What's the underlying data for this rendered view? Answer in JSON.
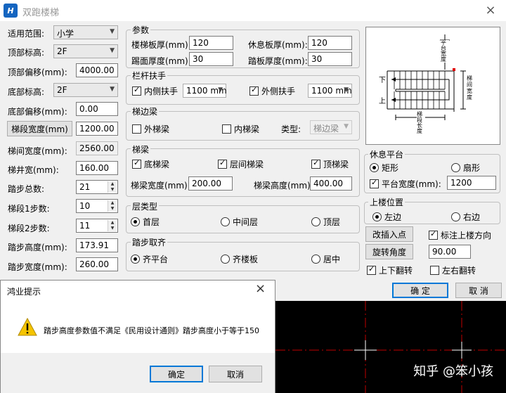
{
  "window": {
    "title": "双跑楼梯",
    "icon": "app-logo-icon",
    "close": "×"
  },
  "left": {
    "scope_label": "适用范围:",
    "scope_value": "小学",
    "top_elev_label": "顶部标高:",
    "top_elev_value": "2F",
    "top_offset_label": "顶部偏移(mm):",
    "top_offset_value": "4000.00",
    "bottom_elev_label": "底部标高:",
    "bottom_elev_value": "2F",
    "bottom_offset_label": "底部偏移(mm):",
    "bottom_offset_value": "0.00",
    "flight_width_button": "梯段宽度(mm)",
    "flight_width_value": "1200.00",
    "gap_width_label": "梯间宽度(mm):",
    "gap_width_value": "2560.00",
    "well_width_label": "梯井宽(mm):",
    "well_width_value": "160.00",
    "total_steps_label": "踏步总数:",
    "total_steps_value": "21",
    "flight1_label": "梯段1步数:",
    "flight1_value": "10",
    "flight2_label": "梯段2步数:",
    "flight2_value": "11",
    "step_height_label": "踏步高度(mm):",
    "step_height_value": "173.91",
    "step_width_label": "踏步宽度(mm):",
    "step_width_value": "260.00"
  },
  "params": {
    "title": "参数",
    "slab_label": "楼梯板厚(mm):",
    "slab_value": "120",
    "landing_label": "休息板厚(mm):",
    "landing_value": "120",
    "riser_label": "踢面厚度(mm):",
    "riser_value": "30",
    "tread_label": "踏板厚度(mm):",
    "tread_value": "30"
  },
  "rail": {
    "title": "栏杆扶手",
    "inner_label": "内侧扶手",
    "inner_value": "1100 mm",
    "outer_label": "外侧扶手",
    "outer_value": "1100 mm"
  },
  "edge_beam": {
    "title": "梯边梁",
    "outer_label": "外梯梁",
    "inner_label": "内梯梁",
    "type_label": "类型:",
    "type_value": "梯边梁"
  },
  "beam": {
    "title": "梯梁",
    "bottom_label": "底梯梁",
    "mid_label": "层间梯梁",
    "top_label": "顶梯梁",
    "width_label": "梯梁宽度(mm):",
    "width_value": "200.00",
    "height_label": "梯梁高度(mm):",
    "height_value": "400.00"
  },
  "floor_type": {
    "title": "层类型",
    "first": "首层",
    "middle": "中间层",
    "top": "顶层"
  },
  "align": {
    "title": "踏步取齐",
    "platform": "齐平台",
    "slab": "齐楼板",
    "center": "居中"
  },
  "preview": {
    "top_label": "平台宽度",
    "side_label": "梯间宽度",
    "bottom_label": "梯段长度",
    "down_label": "下",
    "up_label": "上",
    "accent_color": "#e00000"
  },
  "landing": {
    "title": "休息平台",
    "rect": "矩形",
    "fan": "扇形",
    "width_label": "平台宽度(mm):",
    "width_value": "1200"
  },
  "position": {
    "title": "上楼位置",
    "left": "左边",
    "right": "右边"
  },
  "actions": {
    "change_base": "改插入点",
    "mark_dir": "标注上楼方向",
    "rotate": "旋转角度",
    "rotate_value": "90.00",
    "flip_ud": "上下翻转",
    "flip_lr": "左右翻转",
    "ok": "确 定",
    "cancel": "取 消"
  },
  "dialog": {
    "title": "鸿业提示",
    "close": "×",
    "message": "踏步高度参数值不满足《民用设计通则》踏步高度小于等于150",
    "ok": "确定",
    "cancel": "取消",
    "warn_color": "#f5c400"
  },
  "watermark": "知乎 @笨小孩",
  "cad_color": "#c00000"
}
